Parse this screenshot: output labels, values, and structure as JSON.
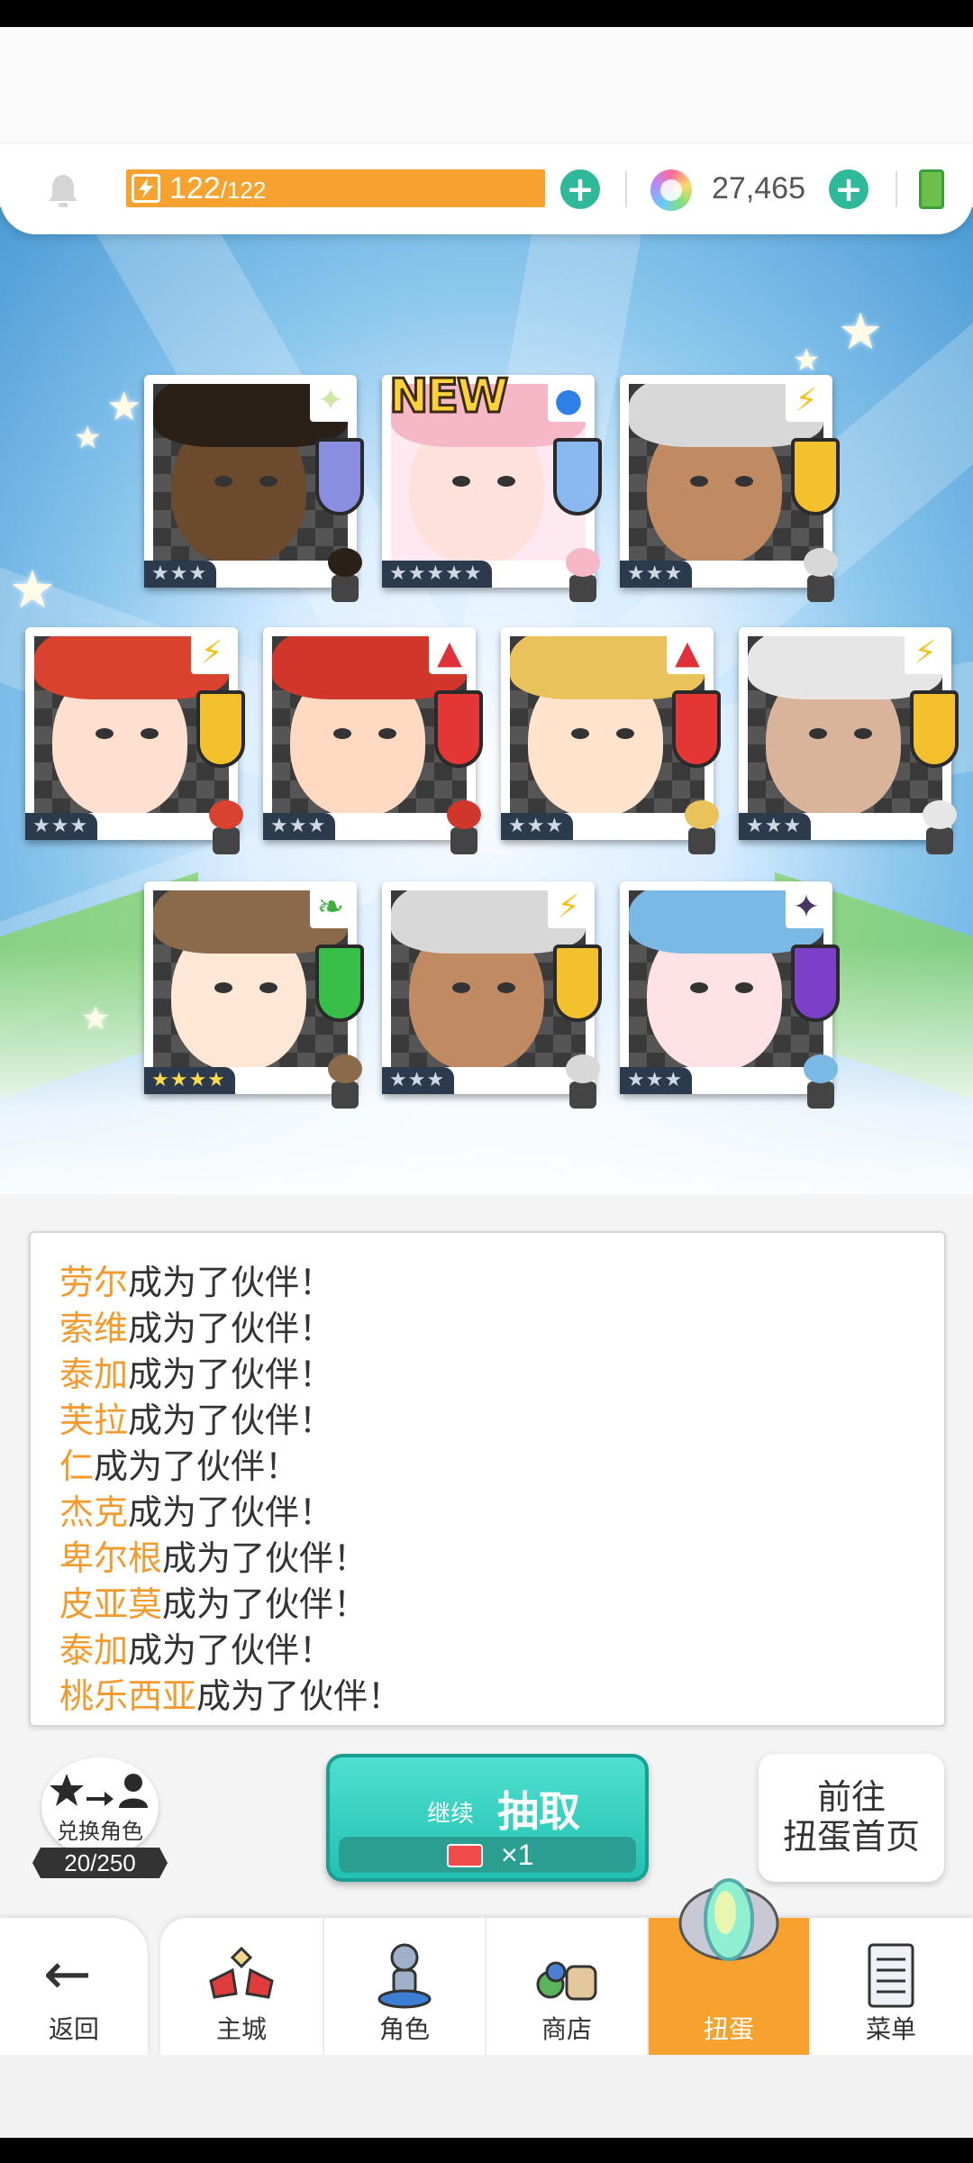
{
  "header": {
    "energy_current": "122",
    "energy_max": "/122",
    "gems": "27,465",
    "plus_symbol": "+",
    "energy_color": "#f7a22e",
    "plus_color": "#2fb99b"
  },
  "results": {
    "new_label": "NEW",
    "cards": [
      {
        "rarity": "★★★",
        "element": "light",
        "skin": "#6b4a2e",
        "hair": "#2a2018"
      },
      {
        "rarity": "★★★★★",
        "element": "water",
        "skin": "#ffe1dc",
        "hair": "#f6b7c6",
        "is_new": true
      },
      {
        "rarity": "★★★",
        "element": "lightning",
        "skin": "#c08a62",
        "hair": "#d8d8d8"
      },
      {
        "rarity": "★★★",
        "element": "lightning",
        "skin": "#ffe0cf",
        "hair": "#d8422e"
      },
      {
        "rarity": "★★★",
        "element": "fire",
        "skin": "#ffd9c2",
        "hair": "#d1362b"
      },
      {
        "rarity": "★★★",
        "element": "fire",
        "skin": "#ffe3cc",
        "hair": "#e9c25a"
      },
      {
        "rarity": "★★★",
        "element": "lightning",
        "skin": "#d9b49a",
        "hair": "#e6e6e6"
      },
      {
        "rarity": "★★★★",
        "element": "earth",
        "skin": "#ffe7d5",
        "hair": "#8a6a4a"
      },
      {
        "rarity": "★★★",
        "element": "lightning",
        "skin": "#c08a62",
        "hair": "#d8d8d8"
      },
      {
        "rarity": "★★★",
        "element": "dark",
        "skin": "#ffe2e6",
        "hair": "#7ab8e6"
      }
    ]
  },
  "log": {
    "suffix": "成为了伙伴！",
    "entries": [
      "劳尔",
      "索维",
      "泰加",
      "芙拉",
      "仁",
      "杰克",
      "卑尔根",
      "皮亚莫",
      "泰加",
      "桃乐西亚"
    ]
  },
  "actions": {
    "exchange_label": "兑换角色",
    "exchange_count": "20/250",
    "continue_label": "继续",
    "draw_label": "抽取",
    "draw_cost": "×1",
    "goto_line1": "前往",
    "goto_line2": "扭蛋首页"
  },
  "nav": {
    "back": "返回",
    "items": [
      "主城",
      "角色",
      "商店",
      "扭蛋",
      "菜单"
    ],
    "active_index": 3
  }
}
